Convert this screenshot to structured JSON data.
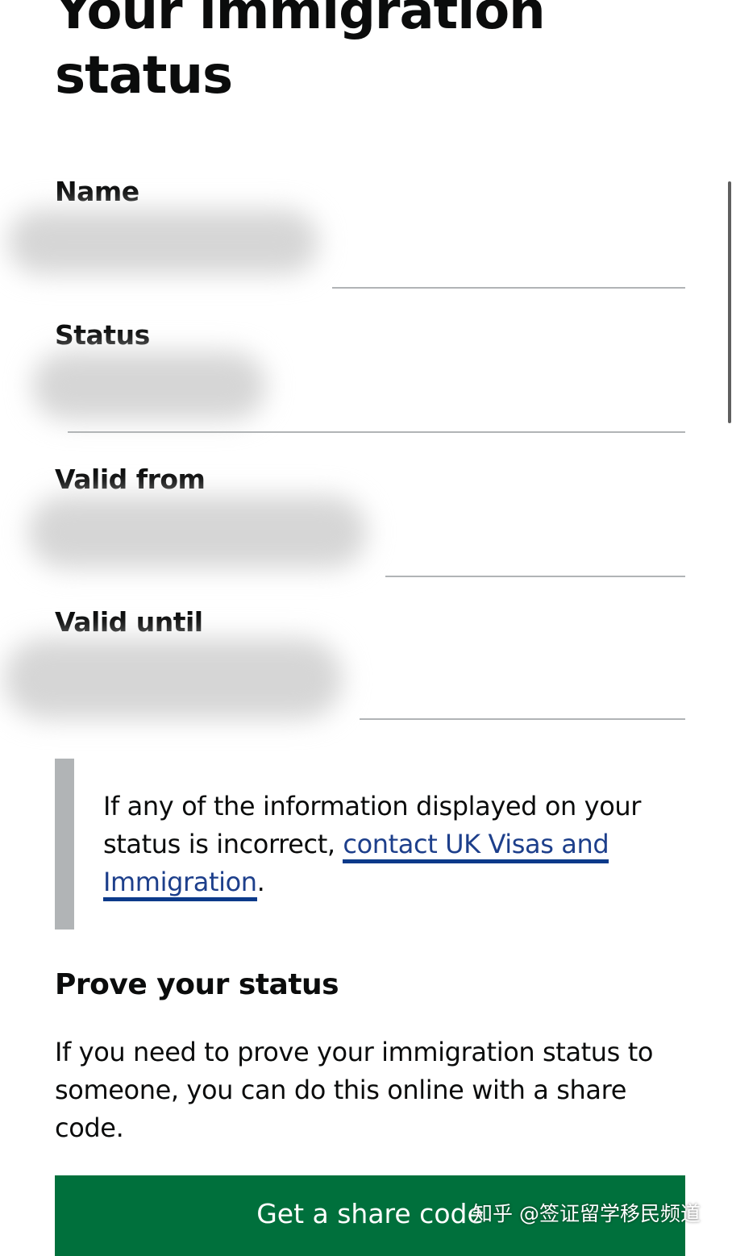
{
  "page": {
    "title": "Your immigration status"
  },
  "details": {
    "name_label": "Name",
    "status_label": "Status",
    "valid_from_label": "Valid from",
    "valid_until_label": "Valid until"
  },
  "inset": {
    "text_before_link": "If any of the information displayed on your status is incorrect, ",
    "link_text": "contact UK Visas and Immigration",
    "text_after_link": "."
  },
  "prove": {
    "heading": "Prove your status",
    "body": "If you need to prove your immigration status to someone, you can do this online with a share code.",
    "button_label": "Get a share code"
  },
  "watermark": {
    "text": "知乎 @签证留学移民频道"
  },
  "colors": {
    "button_green": "#00703c",
    "link_blue": "#1d3f8b",
    "inset_border": "#b1b4b6",
    "text": "#0b0c0c"
  }
}
